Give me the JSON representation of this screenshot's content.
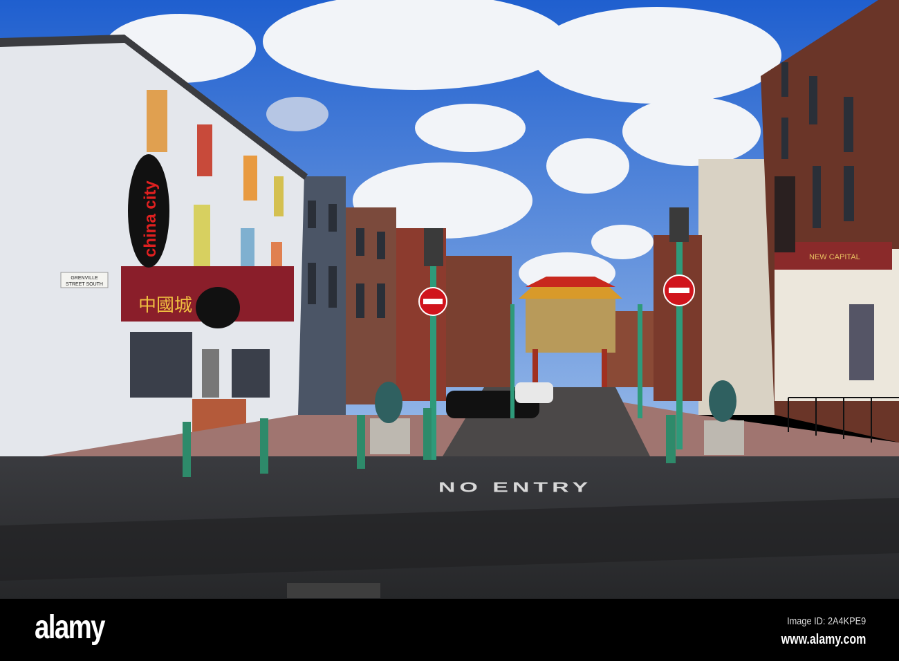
{
  "scene": {
    "street_sign": {
      "line1": "GRENVILLE",
      "line2": "STREET SOUTH"
    },
    "restaurant_sign": "china city",
    "chinese_sign": "中國城",
    "road_marking": "NO ENTRY",
    "right_shop_sign": "NEW CAPITAL"
  },
  "watermark": {
    "logo": "alamy",
    "image_id": "Image ID: 2A4KPE9",
    "url": "www.alamy.com"
  },
  "colors": {
    "sky": "#2f6fd6",
    "building_white": "#e6e8ec",
    "brick": "#6e3a2c",
    "lamp_green": "#2e9a7a",
    "sign_red": "#d0141c"
  }
}
